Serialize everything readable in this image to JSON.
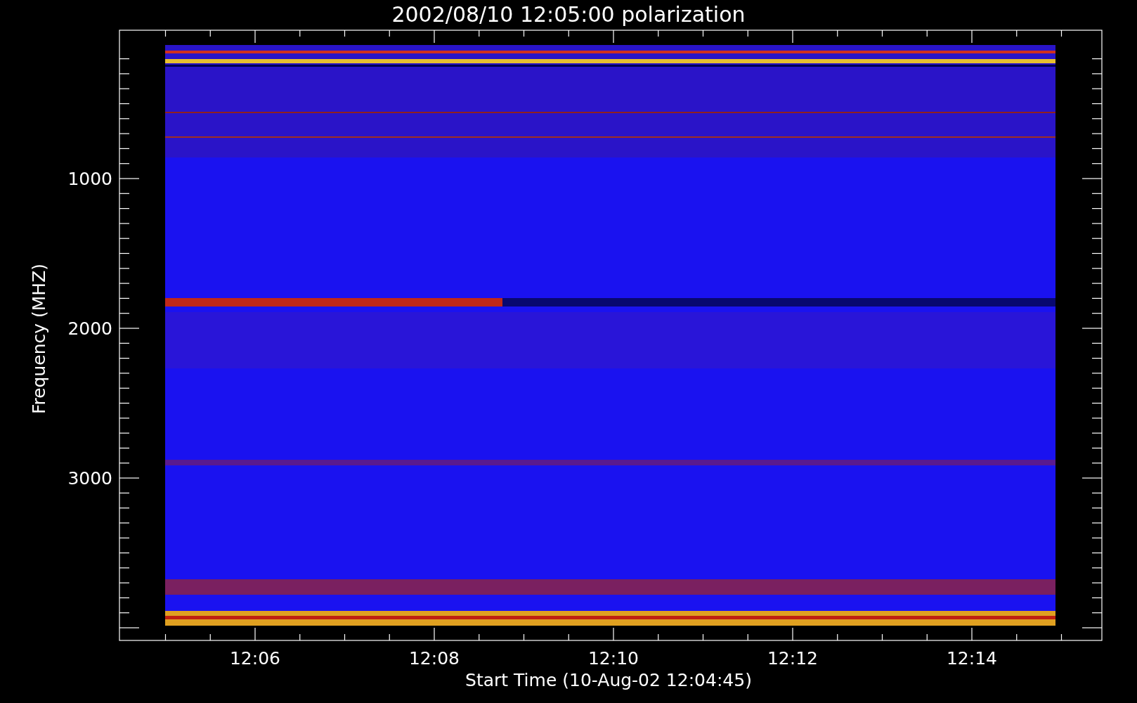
{
  "title": "2002/08/10 12:05:00 polarization",
  "y_axis": {
    "label": "Frequency (MHZ)",
    "ticks": [
      "1000",
      "2000",
      "3000"
    ]
  },
  "x_axis": {
    "label": "Start Time (10-Aug-02 12:04:45)",
    "ticks": [
      "12:06",
      "12:08",
      "12:10",
      "12:12",
      "12:14"
    ]
  }
}
